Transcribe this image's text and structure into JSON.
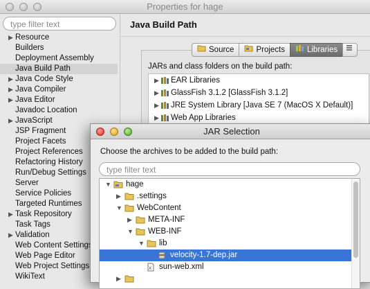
{
  "window": {
    "title": "Properties for hage"
  },
  "sidebar": {
    "filter_placeholder": "type filter text",
    "items": [
      {
        "label": "Resource",
        "expandable": true
      },
      {
        "label": "Builders",
        "expandable": false
      },
      {
        "label": "Deployment Assembly",
        "expandable": false
      },
      {
        "label": "Java Build Path",
        "expandable": false,
        "selected": true
      },
      {
        "label": "Java Code Style",
        "expandable": true
      },
      {
        "label": "Java Compiler",
        "expandable": true
      },
      {
        "label": "Java Editor",
        "expandable": true
      },
      {
        "label": "Javadoc Location",
        "expandable": false
      },
      {
        "label": "JavaScript",
        "expandable": true
      },
      {
        "label": "JSP Fragment",
        "expandable": false
      },
      {
        "label": "Project Facets",
        "expandable": false
      },
      {
        "label": "Project References",
        "expandable": false
      },
      {
        "label": "Refactoring History",
        "expandable": false
      },
      {
        "label": "Run/Debug Settings",
        "expandable": false
      },
      {
        "label": "Server",
        "expandable": false
      },
      {
        "label": "Service Policies",
        "expandable": false
      },
      {
        "label": "Targeted Runtimes",
        "expandable": false
      },
      {
        "label": "Task Repository",
        "expandable": true
      },
      {
        "label": "Task Tags",
        "expandable": false
      },
      {
        "label": "Validation",
        "expandable": true
      },
      {
        "label": "Web Content Settings",
        "expandable": false
      },
      {
        "label": "Web Page Editor",
        "expandable": false
      },
      {
        "label": "Web Project Settings",
        "expandable": false
      },
      {
        "label": "WikiText",
        "expandable": false
      }
    ]
  },
  "page": {
    "title": "Java Build Path",
    "tabs": [
      {
        "label": "Source",
        "icon": "source-folder-icon"
      },
      {
        "label": "Projects",
        "icon": "projects-icon"
      },
      {
        "label": "Libraries",
        "icon": "libraries-icon",
        "active": true
      },
      {
        "label": "",
        "icon": "order-export-icon"
      }
    ],
    "caption": "JARs and class folders on the build path:",
    "libraries": [
      {
        "label": "EAR Libraries"
      },
      {
        "label": "GlassFish 3.1.2 [GlassFish 3.1.2]"
      },
      {
        "label": "JRE System Library [Java SE 7 (MacOS X Default)]"
      },
      {
        "label": "Web App Libraries"
      }
    ]
  },
  "dialog": {
    "title": "JAR Selection",
    "message": "Choose the archives to be added to the build path:",
    "filter_placeholder": "type filter text",
    "tree": [
      {
        "label": "hage",
        "level": 0,
        "state": "expanded",
        "icon": "project-folder-icon"
      },
      {
        "label": ".settings",
        "level": 1,
        "state": "collapsed",
        "icon": "folder-icon"
      },
      {
        "label": "WebContent",
        "level": 1,
        "state": "expanded",
        "icon": "folder-icon"
      },
      {
        "label": "META-INF",
        "level": 2,
        "state": "collapsed",
        "icon": "folder-icon"
      },
      {
        "label": "WEB-INF",
        "level": 2,
        "state": "expanded",
        "icon": "folder-icon"
      },
      {
        "label": "lib",
        "level": 3,
        "state": "expanded",
        "icon": "folder-icon"
      },
      {
        "label": "velocity-1.7-dep.jar",
        "level": 4,
        "state": "leaf",
        "icon": "jar-icon",
        "selected": true
      },
      {
        "label": "sun-web.xml",
        "level": 3,
        "state": "leaf",
        "icon": "xml-file-icon"
      },
      {
        "label": "",
        "level": 1,
        "state": "collapsed",
        "icon": "folder-icon"
      }
    ]
  },
  "colors": {
    "selection": "#3875d7",
    "sidebar_selected": "#d4d4d4",
    "folder": "#e8c55a"
  }
}
